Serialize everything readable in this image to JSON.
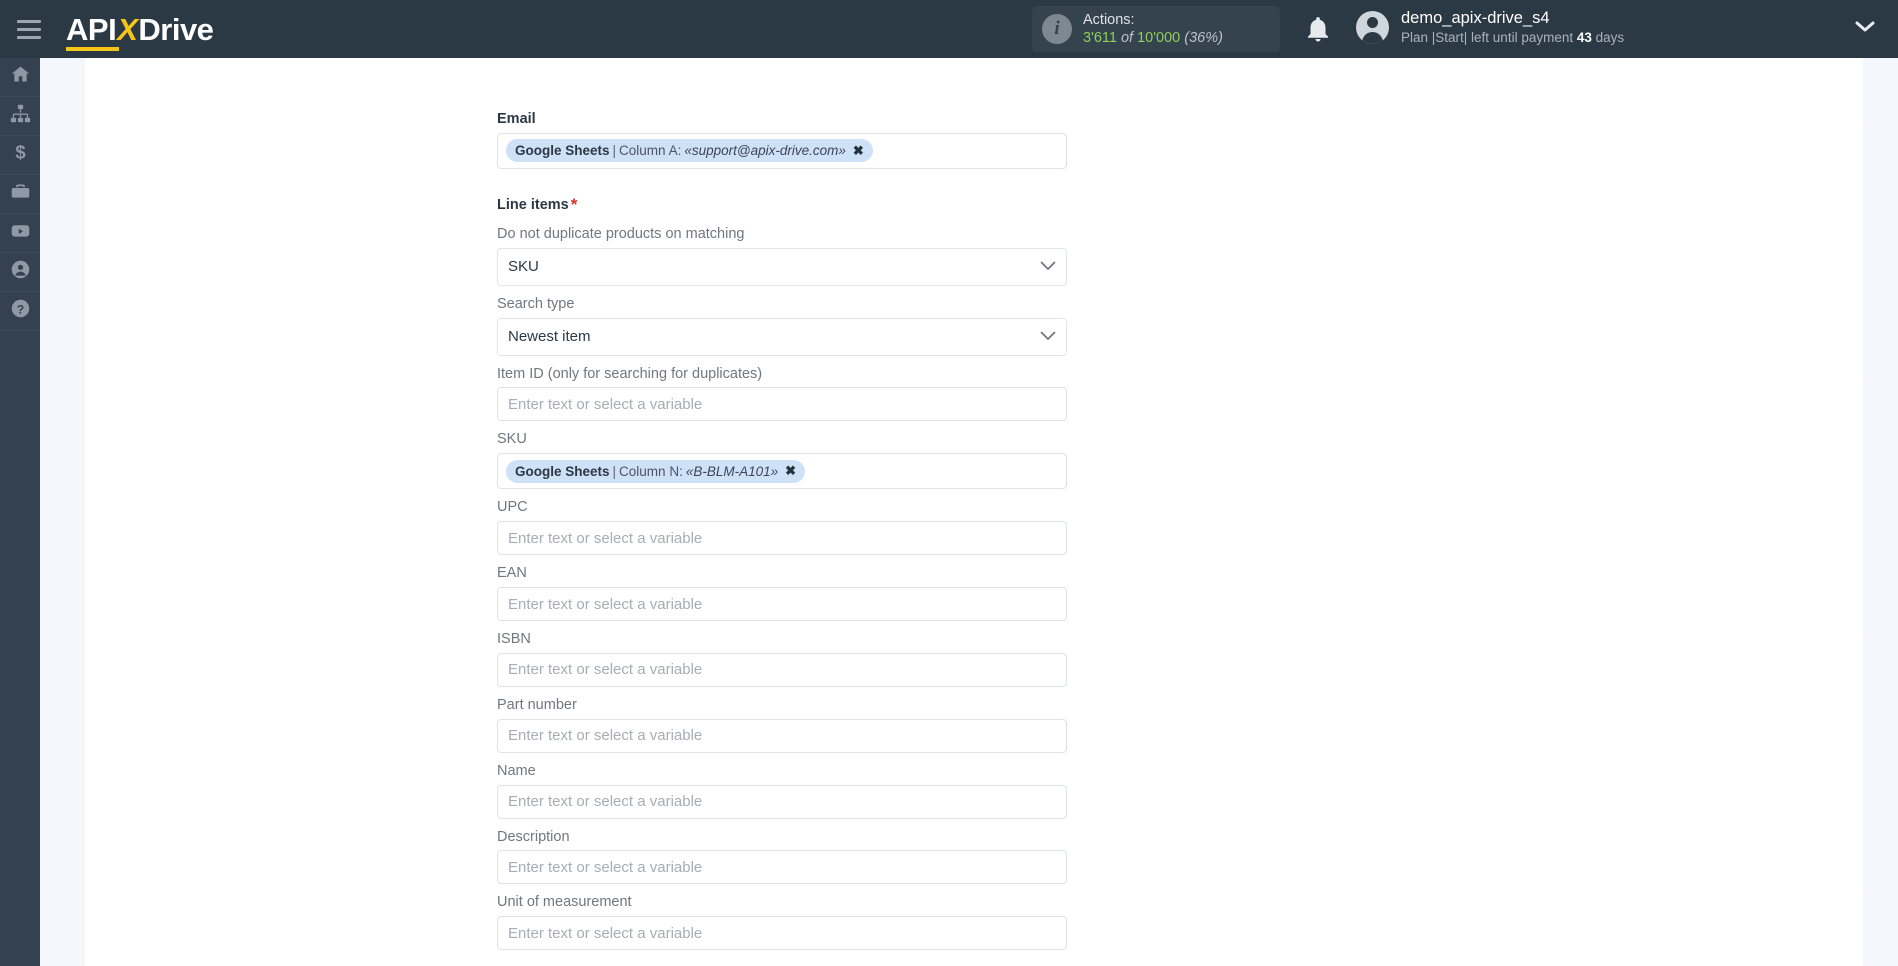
{
  "header": {
    "menu_icon": "hamburger-icon",
    "logo": {
      "part1": "API",
      "x": "X",
      "part2": "Drive"
    },
    "actions": {
      "info_icon": "info-icon",
      "title": "Actions:",
      "used": "3'611",
      "of": "of",
      "total": "10'000",
      "percent": "(36%)"
    },
    "bell_icon": "bell-icon",
    "user": {
      "name": "demo_apix-drive_s4",
      "plan_prefix": "Plan |Start| left until payment ",
      "plan_days": "43",
      "plan_suffix": " days"
    },
    "caret_icon": "chevron-down-icon"
  },
  "sidebar": {
    "items": [
      {
        "name": "home",
        "icon": "home-icon"
      },
      {
        "name": "connections",
        "icon": "sitemap-icon"
      },
      {
        "name": "billing",
        "icon": "dollar-icon"
      },
      {
        "name": "business",
        "icon": "briefcase-icon"
      },
      {
        "name": "video",
        "icon": "youtube-icon"
      },
      {
        "name": "account",
        "icon": "user-circle-icon"
      },
      {
        "name": "help",
        "icon": "question-circle-icon"
      }
    ]
  },
  "form": {
    "email": {
      "label": "Email",
      "chip": {
        "source": "Google Sheets",
        "separator": "|",
        "column": "Column A:",
        "value": "«support@apix-drive.com»",
        "remove": "✖"
      }
    },
    "line_items": {
      "label": "Line items",
      "required_mark": "*"
    },
    "duplicate_matching": {
      "label": "Do not duplicate products on matching",
      "value": "SKU"
    },
    "search_type": {
      "label": "Search type",
      "value": "Newest item"
    },
    "item_id": {
      "label": "Item ID (only for searching for duplicates)",
      "placeholder": "Enter text or select a variable"
    },
    "sku": {
      "label": "SKU",
      "chip": {
        "source": "Google Sheets",
        "separator": "|",
        "column": "Column N:",
        "value": "«B-BLM-A101»",
        "remove": "✖"
      }
    },
    "upc": {
      "label": "UPC",
      "placeholder": "Enter text or select a variable"
    },
    "ean": {
      "label": "EAN",
      "placeholder": "Enter text or select a variable"
    },
    "isbn": {
      "label": "ISBN",
      "placeholder": "Enter text or select a variable"
    },
    "part_number": {
      "label": "Part number",
      "placeholder": "Enter text or select a variable"
    },
    "name": {
      "label": "Name",
      "placeholder": "Enter text or select a variable"
    },
    "description": {
      "label": "Description",
      "placeholder": "Enter text or select a variable"
    },
    "unit_of_measurement": {
      "label": "Unit of measurement",
      "placeholder": "Enter text or select a variable"
    }
  },
  "colors": {
    "header_bg": "#2b3945",
    "sidebar_bg": "#344250",
    "accent_yellow": "#f5c518",
    "actions_green": "#8fcf5a",
    "chip_bg": "#cfe1f7",
    "required_red": "#d0342c"
  }
}
